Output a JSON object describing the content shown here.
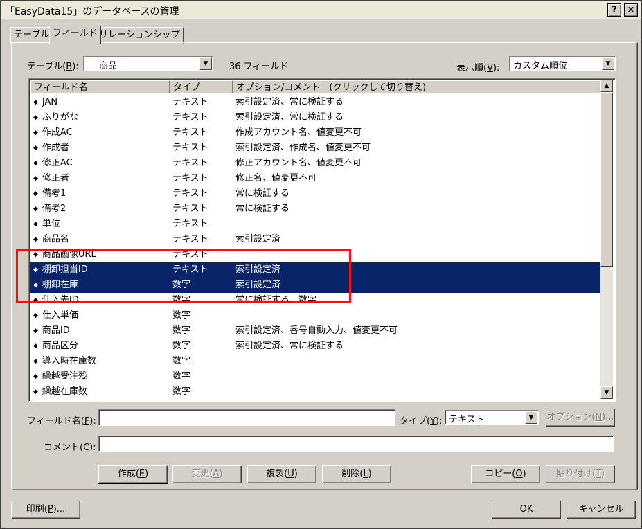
{
  "window": {
    "title": "「EasyData15」のデータベースの管理",
    "help_label": "?",
    "close_label": "×"
  },
  "tabs": [
    {
      "label": "テーブル",
      "active": false
    },
    {
      "label": "フィールド",
      "active": true
    },
    {
      "label": "リレーションシップ",
      "active": false
    }
  ],
  "table_select": {
    "label_prefix": "テーブル(",
    "label_key": "B",
    "label_suffix": "):",
    "value": "商品"
  },
  "field_count": "36 フィールド",
  "sort_select": {
    "label_prefix": "表示順(",
    "label_key": "V",
    "label_suffix": "):",
    "value": "カスタム順位"
  },
  "list": {
    "columns": [
      "フィールド名",
      "タイプ",
      "オプション/コメント　(クリックして切り替え)"
    ],
    "bullet": "◆",
    "rows": [
      {
        "name": "JAN",
        "type": "テキスト",
        "options": "索引設定済、常に検証する",
        "selected": false
      },
      {
        "name": "ふりがな",
        "type": "テキスト",
        "options": "索引設定済、常に検証する",
        "selected": false
      },
      {
        "name": "作成AC",
        "type": "テキスト",
        "options": "作成アカウント名、値変更不可",
        "selected": false
      },
      {
        "name": "作成者",
        "type": "テキスト",
        "options": "索引設定済、作成名、値変更不可",
        "selected": false
      },
      {
        "name": "修正AC",
        "type": "テキスト",
        "options": "修正アカウント名、値変更不可",
        "selected": false
      },
      {
        "name": "修正者",
        "type": "テキスト",
        "options": "修正名、値変更不可",
        "selected": false
      },
      {
        "name": "備考1",
        "type": "テキスト",
        "options": "常に検証する",
        "selected": false
      },
      {
        "name": "備考2",
        "type": "テキスト",
        "options": "常に検証する",
        "selected": false
      },
      {
        "name": "単位",
        "type": "テキスト",
        "options": "",
        "selected": false
      },
      {
        "name": "商品名",
        "type": "テキスト",
        "options": "索引設定済",
        "selected": false
      },
      {
        "name": "商品画像URL",
        "type": "テキスト",
        "options": "",
        "selected": false
      },
      {
        "name": "棚卸担当ID",
        "type": "テキスト",
        "options": "索引設定済",
        "selected": true
      },
      {
        "name": "棚卸在庫",
        "type": "数字",
        "options": "索引設定済",
        "selected": true
      },
      {
        "name": "仕入先ID",
        "type": "数字",
        "options": "常に検証する、数字",
        "selected": false
      },
      {
        "name": "仕入単価",
        "type": "数字",
        "options": "",
        "selected": false
      },
      {
        "name": "商品ID",
        "type": "数字",
        "options": "索引設定済、番号自動入力、値変更不可",
        "selected": false
      },
      {
        "name": "商品区分",
        "type": "数字",
        "options": "索引設定済、常に検証する",
        "selected": false
      },
      {
        "name": "導入時在庫数",
        "type": "数字",
        "options": "",
        "selected": false
      },
      {
        "name": "繰越受注残",
        "type": "数字",
        "options": "",
        "selected": false
      },
      {
        "name": "繰越在庫数",
        "type": "数字",
        "options": "",
        "selected": false
      }
    ]
  },
  "field_name": {
    "label_prefix": "フィールド名(",
    "label_key": "F",
    "label_suffix": "):",
    "value": ""
  },
  "type_select": {
    "label_prefix": "タイプ(",
    "label_key": "Y",
    "label_suffix": "):",
    "value": "テキスト"
  },
  "options_button": {
    "prefix": "オプション(",
    "key": "N",
    "suffix": ")..."
  },
  "comment": {
    "label_prefix": "コメント(",
    "label_key": "C",
    "label_suffix": "):",
    "value": ""
  },
  "buttons": {
    "create": {
      "prefix": "作成(",
      "key": "E",
      "suffix": ")"
    },
    "change": {
      "prefix": "変更(",
      "key": "A",
      "suffix": ")"
    },
    "duplicate": {
      "prefix": "複製(",
      "key": "U",
      "suffix": ")"
    },
    "delete": {
      "prefix": "削除(",
      "key": "L",
      "suffix": ")"
    },
    "copy": {
      "prefix": "コピー(",
      "key": "O",
      "suffix": ")"
    },
    "paste": {
      "prefix": "貼り付け(",
      "key": "T",
      "suffix": ")"
    },
    "print": {
      "prefix": "印刷(",
      "key": "P",
      "suffix": ")..."
    },
    "ok": "OK",
    "cancel": "キャンセル"
  },
  "colors": {
    "selection": "#0a246a",
    "highlight_box": "#e8141c",
    "dialog_face": "#d4d0c8"
  }
}
